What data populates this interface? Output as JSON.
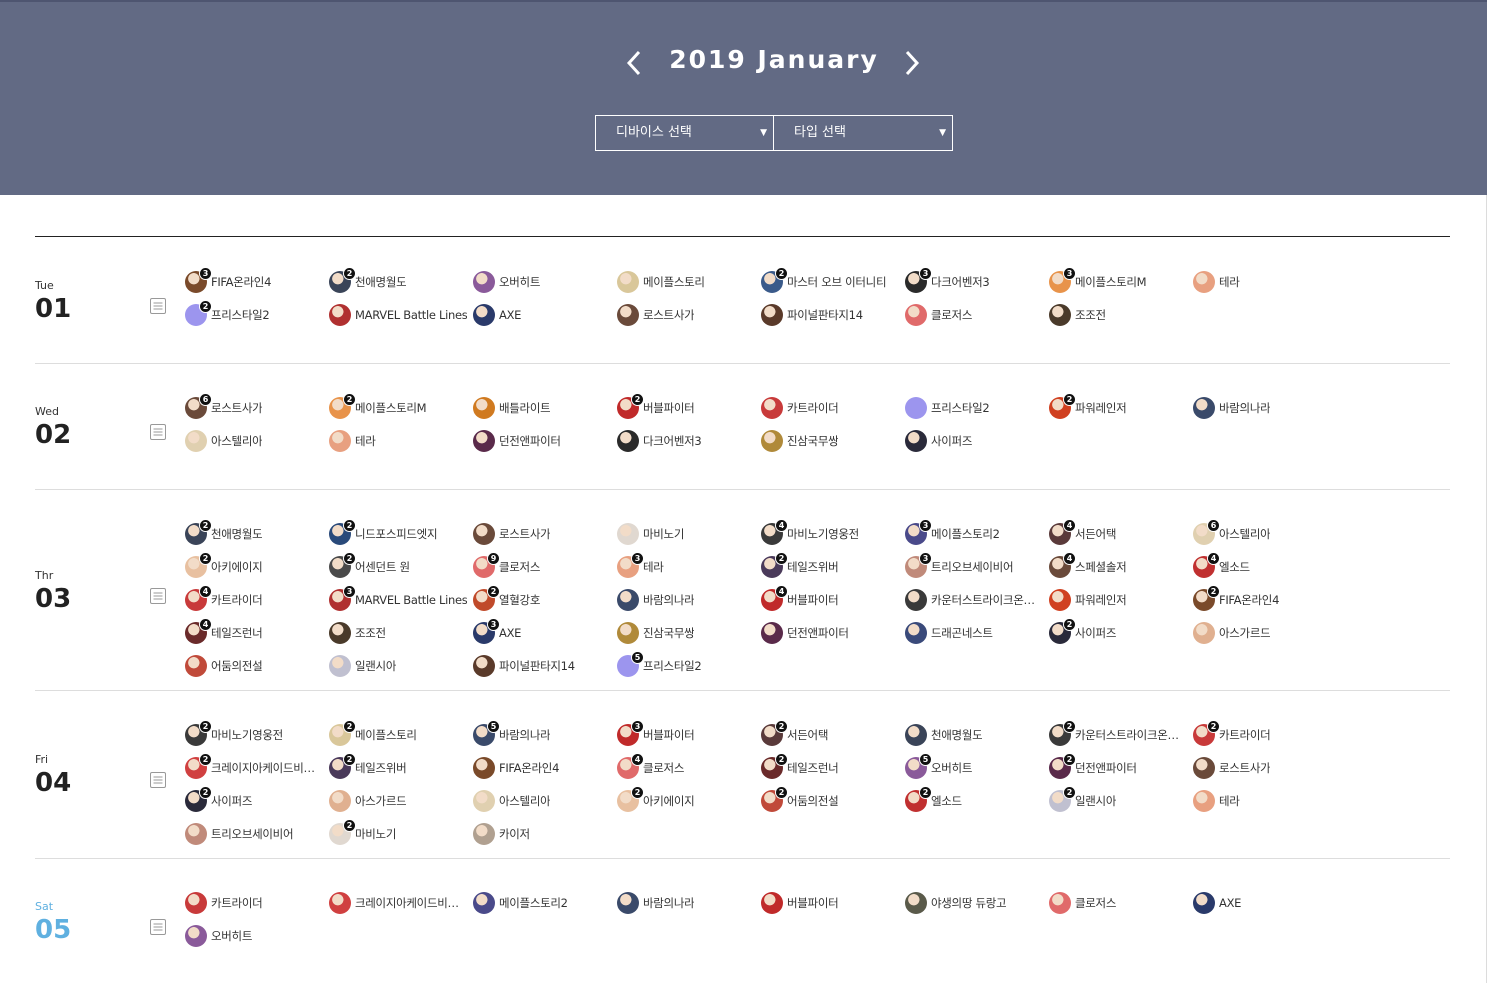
{
  "header": {
    "month_title": "2019 January",
    "device_select": "디바이스 선택",
    "type_select": "타입 선택",
    "bg_color": "#626a84"
  },
  "days": [
    {
      "dow": "Tue",
      "day": "01",
      "saturday": false,
      "games": [
        {
          "name": "FIFA온라인4",
          "badge": "3",
          "color": "#7a4a2a"
        },
        {
          "name": "천애명월도",
          "badge": "2",
          "color": "#3a4458"
        },
        {
          "name": "오버히트",
          "badge": "",
          "color": "#8a5a9a"
        },
        {
          "name": "메이플스토리",
          "badge": "",
          "color": "#d9c79a"
        },
        {
          "name": "마스터 오브 이터니티",
          "badge": "2",
          "color": "#3a5a8a"
        },
        {
          "name": "다크어벤저3",
          "badge": "3",
          "color": "#2a2a2a"
        },
        {
          "name": "메이플스토리M",
          "badge": "3",
          "color": "#e8934a"
        },
        {
          "name": "테라",
          "badge": "",
          "color": "#e8a080"
        },
        {
          "name": "프리스타일2",
          "badge": "2",
          "color": "#9c95ee"
        },
        {
          "name": "MARVEL Battle Lines",
          "badge": "",
          "color": "#b03030"
        },
        {
          "name": "AXE",
          "badge": "",
          "color": "#2a3a6a"
        },
        {
          "name": "로스트사가",
          "badge": "",
          "color": "#6a4a3a"
        },
        {
          "name": "파이널판타지14",
          "badge": "",
          "color": "#5a3a2a"
        },
        {
          "name": "클로저스",
          "badge": "",
          "color": "#e06a6a"
        },
        {
          "name": "조조전",
          "badge": "",
          "color": "#4a3a2a"
        }
      ]
    },
    {
      "dow": "Wed",
      "day": "02",
      "saturday": false,
      "games": [
        {
          "name": "로스트사가",
          "badge": "6",
          "color": "#6a4a3a"
        },
        {
          "name": "메이플스토리M",
          "badge": "2",
          "color": "#e8934a"
        },
        {
          "name": "배틀라이트",
          "badge": "",
          "color": "#d07a20"
        },
        {
          "name": "버블파이터",
          "badge": "2",
          "color": "#c02a2a"
        },
        {
          "name": "카트라이더",
          "badge": "",
          "color": "#c83a3a"
        },
        {
          "name": "프리스타일2",
          "badge": "",
          "color": "#9c95ee"
        },
        {
          "name": "파워레인저",
          "badge": "2",
          "color": "#d04020"
        },
        {
          "name": "바람의나라",
          "badge": "",
          "color": "#3a4a6a"
        },
        {
          "name": "아스텔리아",
          "badge": "",
          "color": "#e0d0b0"
        },
        {
          "name": "테라",
          "badge": "",
          "color": "#e8a080"
        },
        {
          "name": "던전앤파이터",
          "badge": "",
          "color": "#5a2a4a"
        },
        {
          "name": "다크어벤저3",
          "badge": "",
          "color": "#2a2a2a"
        },
        {
          "name": "진삼국무쌍",
          "badge": "",
          "color": "#b08a3a"
        },
        {
          "name": "사이퍼즈",
          "badge": "",
          "color": "#2a2a3a"
        }
      ]
    },
    {
      "dow": "Thr",
      "day": "03",
      "saturday": false,
      "games": [
        {
          "name": "천애명월도",
          "badge": "2",
          "color": "#3a4458"
        },
        {
          "name": "니드포스피드엣지",
          "badge": "2",
          "color": "#2a4a7a"
        },
        {
          "name": "로스트사가",
          "badge": "",
          "color": "#6a4a3a"
        },
        {
          "name": "마비노기",
          "badge": "",
          "color": "#e0d8d0"
        },
        {
          "name": "마비노기영웅전",
          "badge": "4",
          "color": "#3a3a3a"
        },
        {
          "name": "메이플스토리2",
          "badge": "3",
          "color": "#4a4a8a"
        },
        {
          "name": "서든어택",
          "badge": "4",
          "color": "#5a3a3a"
        },
        {
          "name": "아스텔리아",
          "badge": "6",
          "color": "#e0d0b0"
        },
        {
          "name": "아키에이지",
          "badge": "2",
          "color": "#e8c0a0"
        },
        {
          "name": "어센던트 원",
          "badge": "2",
          "color": "#4a4a4a"
        },
        {
          "name": "클로저스",
          "badge": "9",
          "color": "#e06a6a"
        },
        {
          "name": "테라",
          "badge": "3",
          "color": "#e8a080"
        },
        {
          "name": "테일즈위버",
          "badge": "2",
          "color": "#4a3a5a"
        },
        {
          "name": "트리오브세이비어",
          "badge": "3",
          "color": "#c08a7a"
        },
        {
          "name": "스페셜솔저",
          "badge": "4",
          "color": "#6a4a3a"
        },
        {
          "name": "엘소드",
          "badge": "4",
          "color": "#c03030"
        },
        {
          "name": "카트라이더",
          "badge": "4",
          "color": "#c83a3a"
        },
        {
          "name": "MARVEL Battle Lines",
          "badge": "3",
          "color": "#b03030"
        },
        {
          "name": "열혈강호",
          "badge": "2",
          "color": "#c04a2a"
        },
        {
          "name": "바람의나라",
          "badge": "",
          "color": "#3a4a6a"
        },
        {
          "name": "버블파이터",
          "badge": "4",
          "color": "#c02a2a"
        },
        {
          "name": "카운터스트라이크온라인2",
          "badge": "",
          "color": "#3a3a3a"
        },
        {
          "name": "파워레인저",
          "badge": "",
          "color": "#d04020"
        },
        {
          "name": "FIFA온라인4",
          "badge": "2",
          "color": "#7a4a2a"
        },
        {
          "name": "테일즈런너",
          "badge": "4",
          "color": "#6a2a2a"
        },
        {
          "name": "조조전",
          "badge": "",
          "color": "#4a3a2a"
        },
        {
          "name": "AXE",
          "badge": "3",
          "color": "#2a3a6a"
        },
        {
          "name": "진삼국무쌍",
          "badge": "",
          "color": "#b08a3a"
        },
        {
          "name": "던전앤파이터",
          "badge": "",
          "color": "#5a2a4a"
        },
        {
          "name": "드래곤네스트",
          "badge": "",
          "color": "#3a4a7a"
        },
        {
          "name": "사이퍼즈",
          "badge": "2",
          "color": "#2a2a3a"
        },
        {
          "name": "아스가르드",
          "badge": "",
          "color": "#e0b090"
        },
        {
          "name": "어둠의전설",
          "badge": "",
          "color": "#c04a3a"
        },
        {
          "name": "일랜시아",
          "badge": "",
          "color": "#c0c0d0"
        },
        {
          "name": "파이널판타지14",
          "badge": "",
          "color": "#5a3a2a"
        },
        {
          "name": "프리스타일2",
          "badge": "5",
          "color": "#9c95ee"
        }
      ]
    },
    {
      "dow": "Fri",
      "day": "04",
      "saturday": false,
      "games": [
        {
          "name": "마비노기영웅전",
          "badge": "2",
          "color": "#3a3a3a"
        },
        {
          "name": "메이플스토리",
          "badge": "2",
          "color": "#d9c79a"
        },
        {
          "name": "바람의나라",
          "badge": "5",
          "color": "#3a4a6a"
        },
        {
          "name": "버블파이터",
          "badge": "3",
          "color": "#c02a2a"
        },
        {
          "name": "서든어택",
          "badge": "2",
          "color": "#5a3a3a"
        },
        {
          "name": "천애명월도",
          "badge": "",
          "color": "#3a4458"
        },
        {
          "name": "카운터스트라이크온라인2",
          "badge": "2",
          "color": "#3a3a3a"
        },
        {
          "name": "카트라이더",
          "badge": "2",
          "color": "#c83a3a"
        },
        {
          "name": "크레이지아케이드비엔비",
          "badge": "2",
          "color": "#d04040"
        },
        {
          "name": "테일즈위버",
          "badge": "2",
          "color": "#4a3a5a"
        },
        {
          "name": "FIFA온라인4",
          "badge": "",
          "color": "#7a4a2a"
        },
        {
          "name": "클로저스",
          "badge": "4",
          "color": "#e06a6a"
        },
        {
          "name": "테일즈런너",
          "badge": "2",
          "color": "#6a2a2a"
        },
        {
          "name": "오버히트",
          "badge": "5",
          "color": "#8a5a9a"
        },
        {
          "name": "던전앤파이터",
          "badge": "2",
          "color": "#5a2a4a"
        },
        {
          "name": "로스트사가",
          "badge": "",
          "color": "#6a4a3a"
        },
        {
          "name": "사이퍼즈",
          "badge": "2",
          "color": "#2a2a3a"
        },
        {
          "name": "아스가르드",
          "badge": "",
          "color": "#e0b090"
        },
        {
          "name": "아스텔리아",
          "badge": "",
          "color": "#e0d0b0"
        },
        {
          "name": "아키에이지",
          "badge": "2",
          "color": "#e8c0a0"
        },
        {
          "name": "어둠의전설",
          "badge": "2",
          "color": "#c04a3a"
        },
        {
          "name": "엘소드",
          "badge": "2",
          "color": "#c03030"
        },
        {
          "name": "일랜시아",
          "badge": "2",
          "color": "#c0c0d0"
        },
        {
          "name": "테라",
          "badge": "",
          "color": "#e8a080"
        },
        {
          "name": "트리오브세이비어",
          "badge": "",
          "color": "#c08a7a"
        },
        {
          "name": "마비노기",
          "badge": "2",
          "color": "#e0d8d0"
        },
        {
          "name": "카이저",
          "badge": "",
          "color": "#b0a090"
        }
      ]
    },
    {
      "dow": "Sat",
      "day": "05",
      "saturday": true,
      "games": [
        {
          "name": "카트라이더",
          "badge": "",
          "color": "#c83a3a"
        },
        {
          "name": "크레이지아케이드비엔비",
          "badge": "",
          "color": "#d04040"
        },
        {
          "name": "메이플스토리2",
          "badge": "",
          "color": "#4a4a8a"
        },
        {
          "name": "바람의나라",
          "badge": "",
          "color": "#3a4a6a"
        },
        {
          "name": "버블파이터",
          "badge": "",
          "color": "#c02a2a"
        },
        {
          "name": "야생의땅 듀랑고",
          "badge": "",
          "color": "#5a5a4a"
        },
        {
          "name": "클로저스",
          "badge": "",
          "color": "#e06a6a"
        },
        {
          "name": "AXE",
          "badge": "",
          "color": "#2a3a6a"
        },
        {
          "name": "오버히트",
          "badge": "",
          "color": "#8a5a9a"
        }
      ]
    }
  ]
}
